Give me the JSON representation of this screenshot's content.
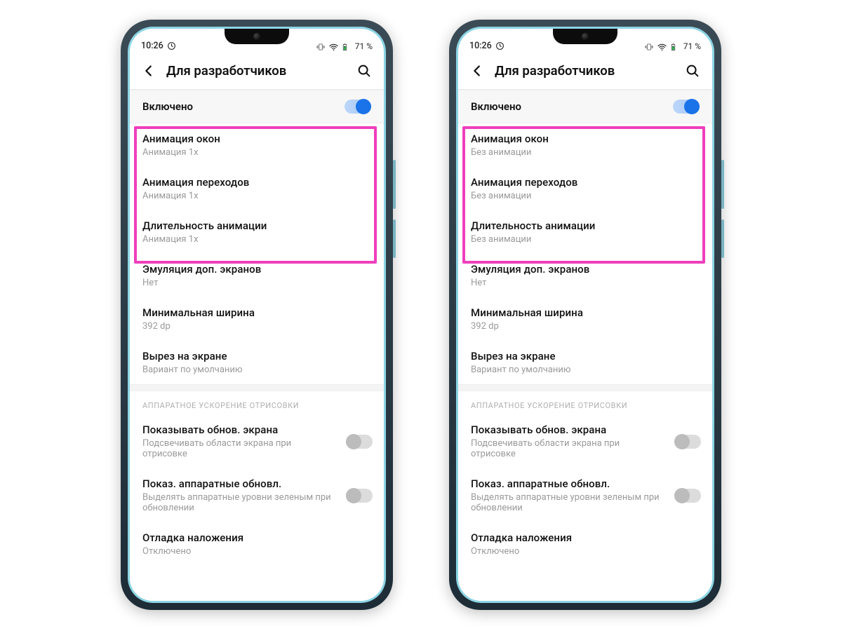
{
  "phones": [
    {
      "statusbar": {
        "time": "10:26",
        "battery_pct": "71 %"
      },
      "header": {
        "title": "Для разработчиков"
      },
      "enabled": {
        "label": "Включено",
        "on": true
      },
      "items": [
        {
          "title": "Анимация окон",
          "sub": "Анимация 1x"
        },
        {
          "title": "Анимация переходов",
          "sub": "Анимация 1x"
        },
        {
          "title": "Длительность анимации",
          "sub": "Анимация 1x"
        },
        {
          "title": "Эмуляция доп. экранов",
          "sub": "Нет"
        },
        {
          "title": "Минимальная ширина",
          "sub": "392 dp"
        },
        {
          "title": "Вырез на экране",
          "sub": "Вариант по умолчанию"
        }
      ],
      "section2_header": "АППАРАТНОЕ УСКОРЕНИЕ ОТРИСОВКИ",
      "toggles": [
        {
          "title": "Показывать обнов. экрана",
          "sub": "Подсвечивать области экрана при отрисовке",
          "on": false
        },
        {
          "title": "Показ. аппаратные обновл.",
          "sub": "Выделять аппаратные уровни зеленым при обновлении",
          "on": false
        }
      ],
      "last": {
        "title": "Отладка наложения",
        "sub": "Отключено"
      }
    },
    {
      "statusbar": {
        "time": "10:26",
        "battery_pct": "71 %"
      },
      "header": {
        "title": "Для разработчиков"
      },
      "enabled": {
        "label": "Включено",
        "on": true
      },
      "items": [
        {
          "title": "Анимация окон",
          "sub": "Без анимации"
        },
        {
          "title": "Анимация переходов",
          "sub": "Без анимации"
        },
        {
          "title": "Длительность анимации",
          "sub": "Без анимации"
        },
        {
          "title": "Эмуляция доп. экранов",
          "sub": "Нет"
        },
        {
          "title": "Минимальная ширина",
          "sub": "392 dp"
        },
        {
          "title": "Вырез на экране",
          "sub": "Вариант по умолчанию"
        }
      ],
      "section2_header": "АППАРАТНОЕ УСКОРЕНИЕ ОТРИСОВКИ",
      "toggles": [
        {
          "title": "Показывать обнов. экрана",
          "sub": "Подсвечивать области экрана при отрисовке",
          "on": false
        },
        {
          "title": "Показ. аппаратные обновл.",
          "sub": "Выделять аппаратные уровни зеленым при обновлении",
          "on": false
        }
      ],
      "last": {
        "title": "Отладка наложения",
        "sub": "Отключено"
      }
    }
  ]
}
